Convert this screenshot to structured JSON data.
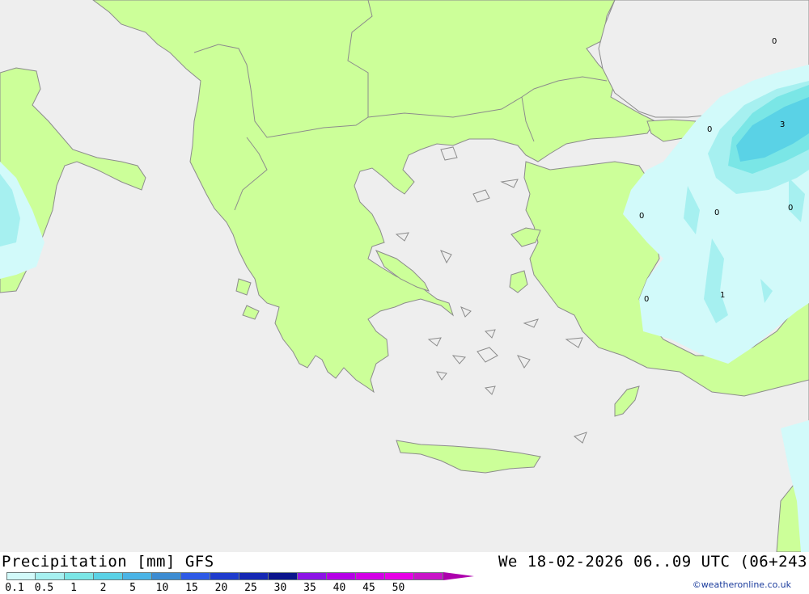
{
  "map": {
    "colors": {
      "sea": "#eeeeee",
      "land": "#ccff99",
      "outline": "#8c8c8c",
      "precip_light": "#d2fafa",
      "precip_mid": "#a6f0f0",
      "precip_high": "#7ae6e6",
      "precip_peak": "#5ad2e6"
    },
    "contour_labels": [
      {
        "name": "contour-label-0-ne",
        "text": "0"
      },
      {
        "name": "contour-label-3",
        "text": "3"
      },
      {
        "name": "contour-label-0-thrace",
        "text": "0"
      },
      {
        "name": "contour-label-0-west",
        "text": "0"
      },
      {
        "name": "contour-label-0-mid",
        "text": "0"
      },
      {
        "name": "contour-label-0-east",
        "text": "0"
      },
      {
        "name": "contour-label-0-south",
        "text": "0"
      },
      {
        "name": "contour-label-1",
        "text": "1"
      }
    ]
  },
  "footer": {
    "title_left": "Precipitation [mm] GFS",
    "title_right": "We 18-02-2026 06..09 UTC (06+243",
    "credit": "©weatheronline.co.uk",
    "legend_colors": [
      "#d2fafa",
      "#a6f0f0",
      "#7ae6e6",
      "#5ad2e6",
      "#4ab4e6",
      "#3c8cd2",
      "#2d5ae6",
      "#1e3ccd",
      "#1428b4",
      "#0a148c",
      "#8c14e6",
      "#b400e6",
      "#d200e6",
      "#e600e6",
      "#c814c8"
    ],
    "legend_arrow_color": "#ad00ad",
    "tick_labels": [
      "0.1",
      "0.5",
      "1",
      "2",
      "5",
      "10",
      "15",
      "20",
      "25",
      "30",
      "35",
      "40",
      "45",
      "50"
    ]
  }
}
